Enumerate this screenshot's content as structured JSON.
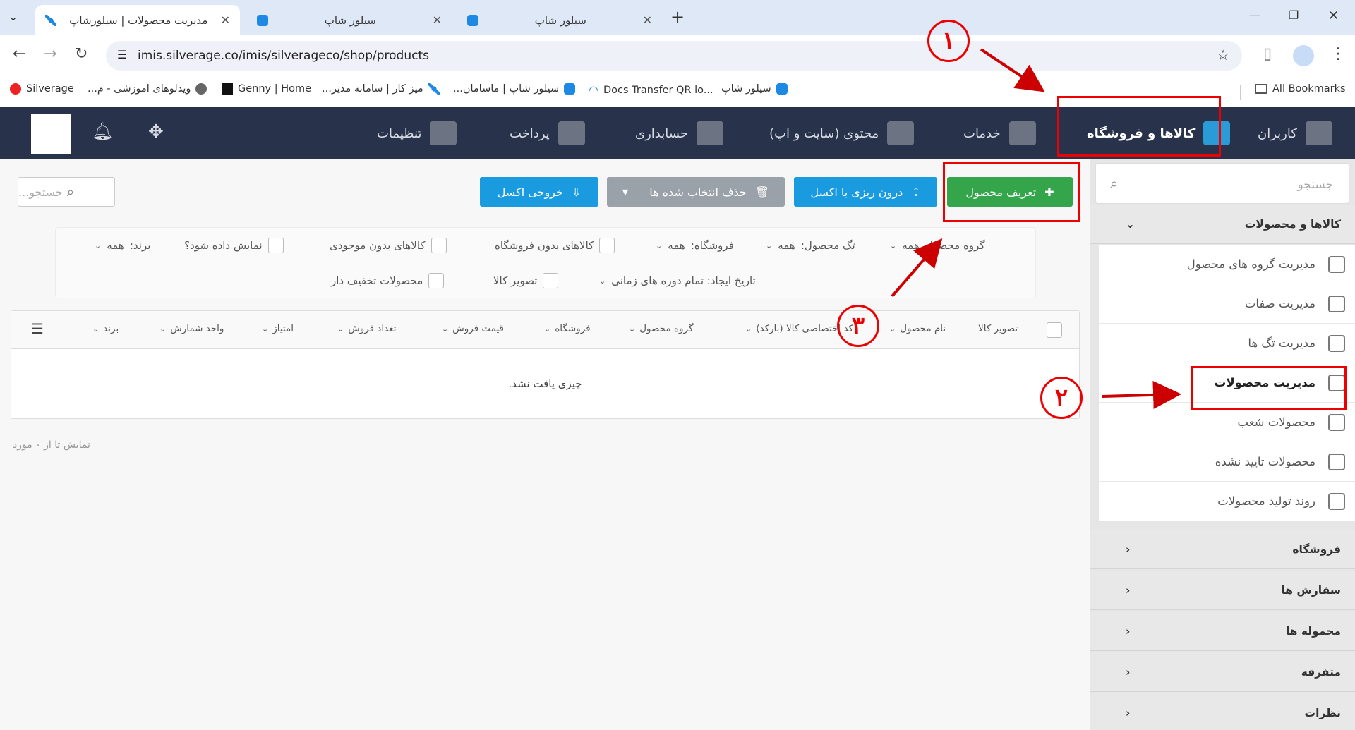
{
  "browser": {
    "tabs": [
      {
        "title": "مدیریت محصولات | سیلورشاپ",
        "close": "✕"
      },
      {
        "title": "سیلور شاپ",
        "close": "✕"
      },
      {
        "title": "سیلور شاپ",
        "close": "✕"
      }
    ],
    "new_tab": "+",
    "url": "imis.silverage.co/imis/silverageco/shop/products",
    "bookmarks": [
      "Silverage",
      "ویدلوهای آموزشی - م...",
      "Genny | Home",
      "میز کار | سامانه مدیر...",
      "سیلور شاپ | ماسامان...",
      "Docs Transfer QR lo...",
      "سیلور شاپ"
    ],
    "all_bookmarks": "All Bookmarks",
    "window_controls": {
      "min": "—",
      "max": "❐",
      "close": "✕"
    }
  },
  "nav": {
    "items": [
      {
        "label": "کاربران",
        "icon": "users-icon"
      },
      {
        "label": "کالاها و فروشگاه",
        "icon": "cart-icon"
      },
      {
        "label": "خدمات",
        "icon": "broom-icon"
      },
      {
        "label": "محتوی (سایت و اپ)",
        "icon": "folder-icon"
      },
      {
        "label": "حسابداری",
        "icon": "calculator-icon"
      },
      {
        "label": "پرداخت",
        "icon": "card-icon"
      },
      {
        "label": "تنظیمات",
        "icon": "gears-icon"
      }
    ]
  },
  "sidebar": {
    "search_placeholder": "جستجو",
    "sections": [
      {
        "label": "کالاها و محصولات",
        "open": true
      },
      {
        "label": "فروشگاه"
      },
      {
        "label": "سفارش ها"
      },
      {
        "label": "محموله ها"
      },
      {
        "label": "متفرقه"
      },
      {
        "label": "نظرات"
      }
    ],
    "items": [
      "مدیریت گروه های محصول",
      "مدیریت صفات",
      "مدیریت تگ ها",
      "مدیریت محصولات",
      "محصولات شعب",
      "محصولات تایید نشده",
      "روند تولید محصولات"
    ]
  },
  "toolbar": {
    "define_product": "تعریف محصول",
    "import_excel": "درون ریزی با اکسل",
    "delete_selected": "حذف انتخاب شده ها",
    "export_excel": "خروجی اکسل",
    "search_placeholder": "جستجو..."
  },
  "filters": {
    "product_group": "گروه محصول",
    "product_group_value": "همه",
    "product_tag": "تگ محصول:",
    "product_tag_value": "همه",
    "store": "فروشگاه:",
    "store_value": "همه",
    "no_store": "کالاهای بدون فروشگاه",
    "no_stock": "کالاهای بدون موجودی",
    "show": "نمایش داده شود؟",
    "brand": "برند:",
    "brand_value": "همه",
    "created": "تاریخ ایجاد: تمام دوره های زمانی",
    "product_image": "تصویر کالا",
    "discounted": "محصولات تخفیف دار"
  },
  "table": {
    "columns": [
      "تصویر کالا",
      "نام محصول",
      "کد اختصاصی کالا (بارکد)",
      "گروه محصول",
      "فروشگاه",
      "قیمت فروش",
      "تعداد فروش",
      "امتیاز",
      "واحد شمارش",
      "برند"
    ],
    "empty": "چیزی یافت نشد.",
    "pagination": "نمایش تا از ۰ مورد"
  },
  "annotations": [
    "۱",
    "۲",
    "۳"
  ],
  "colors": {
    "nav_bg": "#28324a",
    "green": "#34a54a",
    "blue": "#1a9be0",
    "gray_btn": "#9aa1a9",
    "annotation": "#e00000"
  }
}
